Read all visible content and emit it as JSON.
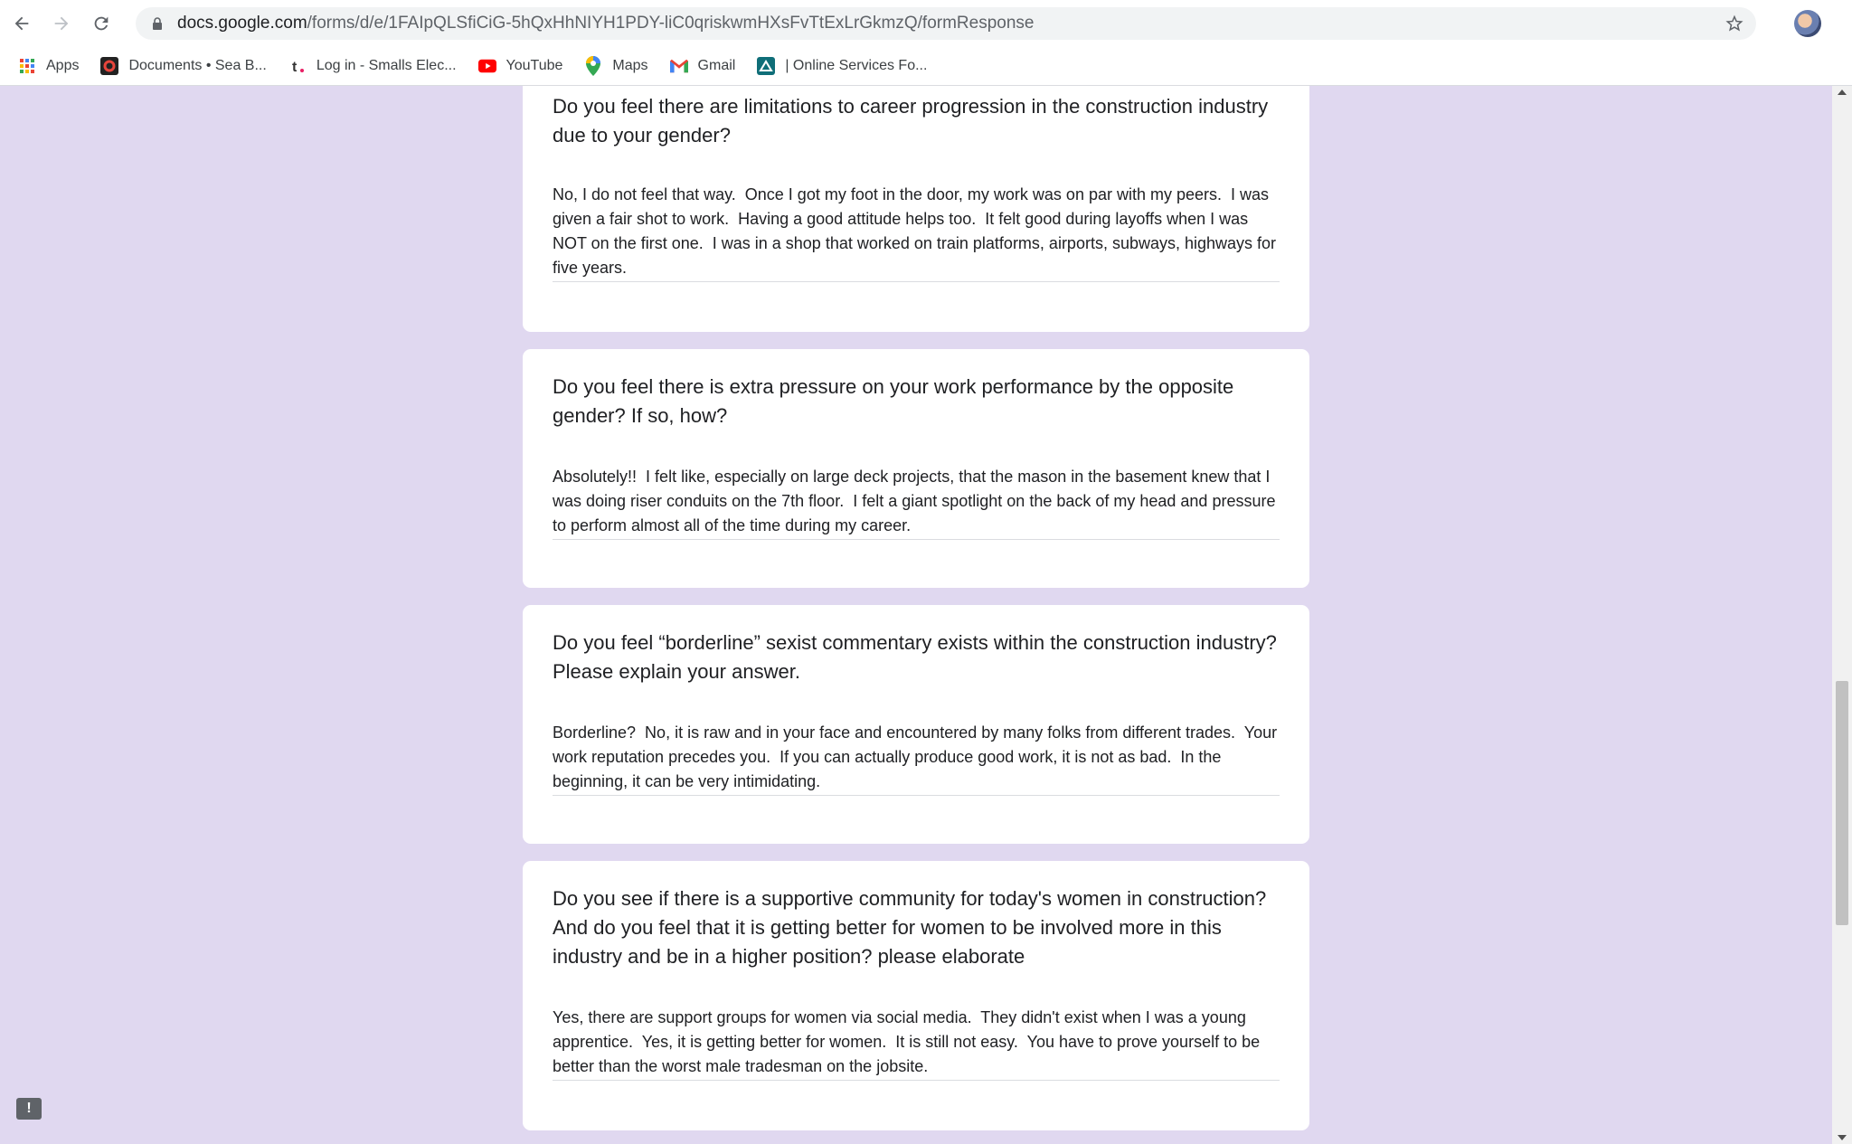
{
  "browser": {
    "url_domain": "docs.google.com",
    "url_path": "/forms/d/e/1FAIpQLSfiCiG-5hQxHhNIYH1PDY-liC0qriskwmHXsFvTtExLrGkmzQ/formResponse"
  },
  "bookmarks": [
    {
      "label": "Apps",
      "icon": "apps-grid-icon"
    },
    {
      "label": "Documents • Sea B...",
      "icon": "documents-icon"
    },
    {
      "label": "Log in - Smalls Elec...",
      "icon": "smalls-icon"
    },
    {
      "label": "YouTube",
      "icon": "youtube-icon"
    },
    {
      "label": "Maps",
      "icon": "maps-icon"
    },
    {
      "label": "Gmail",
      "icon": "gmail-icon"
    },
    {
      "label": "| Online Services Fo...",
      "icon": "online-services-icon"
    }
  ],
  "questions": [
    {
      "question": "Do you feel there are limitations to career progression in the construction industry due to your gender?",
      "answer": "No, I do not feel that way.  Once I got my foot in the door, my work was on par with my peers.  I was given a fair shot to work.  Having a good attitude helps too.  It felt good during layoffs when I was NOT on the first one.  I was in a shop that worked on train platforms, airports, subways, highways for five years."
    },
    {
      "question": "Do you feel there is extra pressure on your work performance by the opposite gender? If so, how?",
      "answer": "Absolutely!!  I felt like, especially on large deck projects, that the mason in the basement knew that I was doing riser conduits on the 7th floor.  I felt a giant spotlight on the back of my head and pressure to perform almost all of the time during my career."
    },
    {
      "question": "Do you feel “borderline” sexist commentary exists within the construction industry? Please explain your answer.",
      "answer": "Borderline?  No, it is raw and in your face and encountered by many folks from different trades.  Your work reputation precedes you.  If you can actually produce good work, it is not as bad.  In the beginning, it can be very intimidating."
    },
    {
      "question": "Do you see if there is a supportive community for today's women in construction? And do you feel that it is getting better for women to be involved more in this industry and be in a higher position? please elaborate",
      "answer": "Yes, there are support groups for women via social media.  They didn't exist when I was a young apprentice.  Yes, it is getting better for women.  It is still not easy.  You have to prove yourself to be better than the worst male tradesman on the jobsite."
    }
  ],
  "feedback_label": "!"
}
